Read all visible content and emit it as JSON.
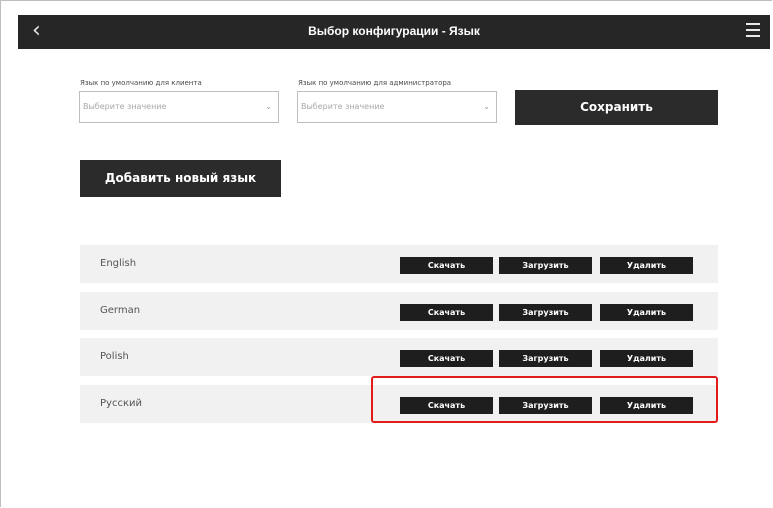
{
  "header": {
    "title": "Выбор конфигурации - Язык",
    "back_icon": "chevron-left-icon",
    "menu_icon": "hamburger-menu-icon"
  },
  "settings": {
    "client_label": "Язык по умолчанию для клиента",
    "client_placeholder": "Выберите значение",
    "admin_label": "Язык по умолчанию для администратора",
    "admin_placeholder": "Выберите значение",
    "save_label": "Сохранить"
  },
  "add_language_label": "Добавить новый язык",
  "languages": [
    {
      "name": "English",
      "download": "Скачать",
      "upload": "Загрузить",
      "delete": "Удалить"
    },
    {
      "name": "German",
      "download": "Скачать",
      "upload": "Загрузить",
      "delete": "Удалить"
    },
    {
      "name": "Polish",
      "download": "Скачать",
      "upload": "Загрузить",
      "delete": "Удалить"
    },
    {
      "name": "Русский",
      "download": "Скачать",
      "upload": "Загрузить",
      "delete": "Удалить"
    }
  ],
  "colors": {
    "header_bg": "#262626",
    "button_bg": "#2b2b2b",
    "row_bg": "#f1f1f1",
    "highlight": "#e21b1b"
  }
}
